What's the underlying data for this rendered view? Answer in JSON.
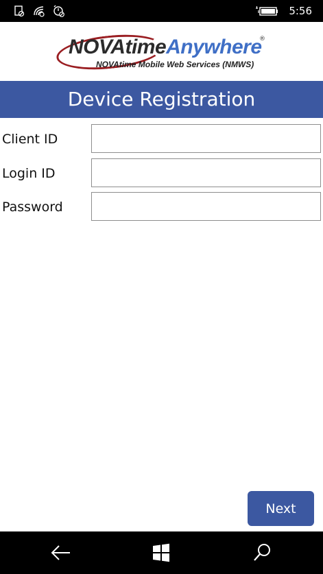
{
  "status_bar": {
    "time": "5:56",
    "icons": [
      "notification-blocked-icon",
      "wifi-icon",
      "alarm-off-icon",
      "battery-charging-icon"
    ]
  },
  "logo": {
    "title_part1": "NOVAtime",
    "title_part2": "Anywhere",
    "registered": "®",
    "subtitle": "NOVAtime Mobile Web Services (NMWS)"
  },
  "header": {
    "title": "Device Registration"
  },
  "form": {
    "client_id": {
      "label": "Client ID",
      "value": ""
    },
    "login_id": {
      "label": "Login ID",
      "value": ""
    },
    "password": {
      "label": "Password",
      "value": ""
    }
  },
  "next_button": {
    "label": "Next"
  },
  "nav_bar": {
    "icons": [
      "back-icon",
      "windows-start-icon",
      "search-icon"
    ]
  },
  "colors": {
    "accent": "#3c58a1",
    "logo_red": "#9a1e22",
    "logo_blue": "#3f6fc6"
  }
}
